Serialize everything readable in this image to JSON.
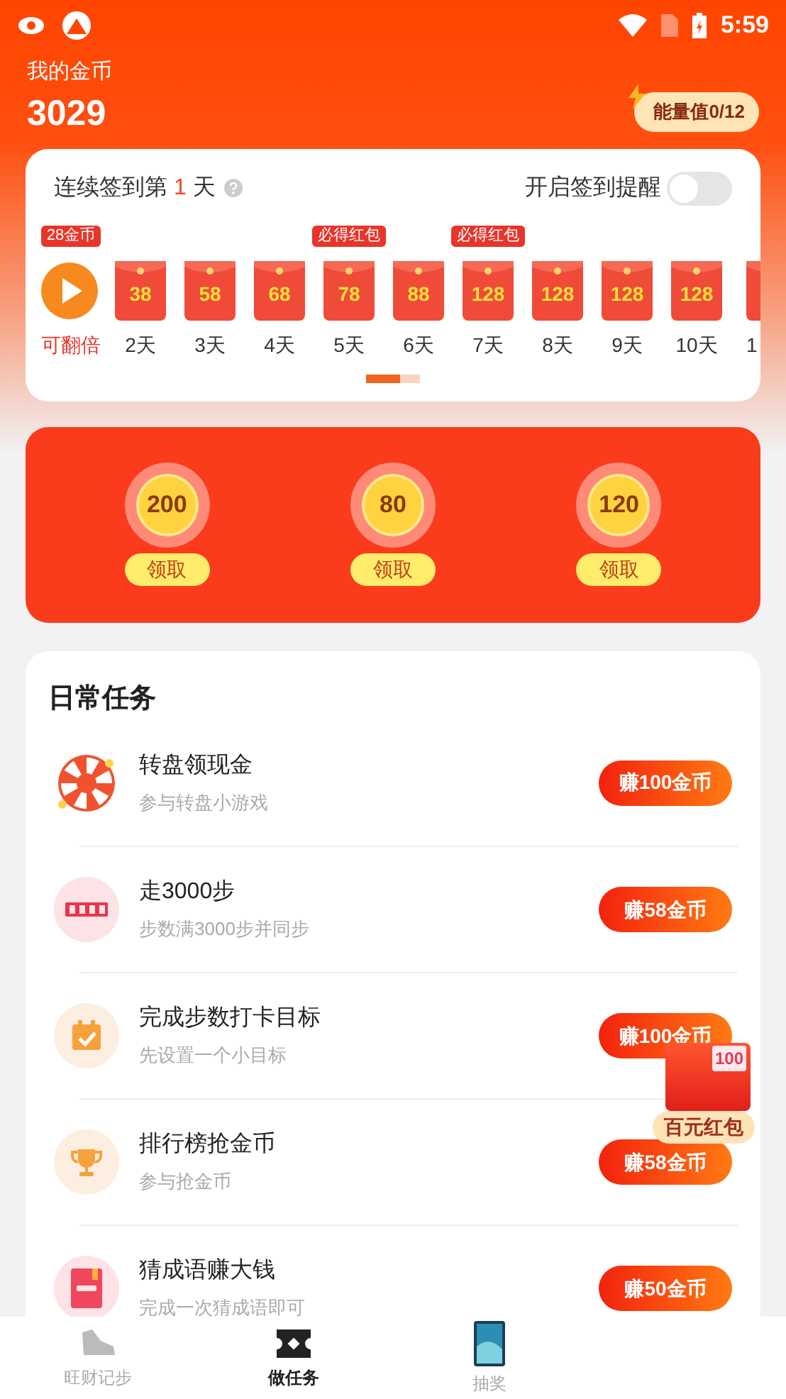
{
  "status_bar": {
    "time": "5:59"
  },
  "header": {
    "label": "我的金币",
    "coins": "3029",
    "energy": "能量值0/12"
  },
  "checkin": {
    "title_before": "连续签到第",
    "day": "1",
    "title_after": "天",
    "reminder_label": "开启签到提醒",
    "reminder_on": false,
    "days": [
      {
        "kind": "video",
        "label": "可翻倍",
        "badge": "28金币"
      },
      {
        "kind": "packet",
        "label": "2天",
        "amount": "38"
      },
      {
        "kind": "packet",
        "label": "3天",
        "amount": "58"
      },
      {
        "kind": "packet",
        "label": "4天",
        "amount": "68"
      },
      {
        "kind": "packet",
        "label": "5天",
        "amount": "78",
        "badge": "必得红包"
      },
      {
        "kind": "packet",
        "label": "6天",
        "amount": "88"
      },
      {
        "kind": "packet",
        "label": "7天",
        "amount": "128",
        "badge": "必得红包"
      },
      {
        "kind": "packet",
        "label": "8天",
        "amount": "128"
      },
      {
        "kind": "packet",
        "label": "9天",
        "amount": "128"
      },
      {
        "kind": "packet",
        "label": "10天",
        "amount": "128"
      },
      {
        "kind": "packet",
        "label": "1"
      }
    ]
  },
  "rewards": [
    {
      "amount": "200",
      "button": "领取"
    },
    {
      "amount": "80",
      "button": "领取"
    },
    {
      "amount": "120",
      "button": "领取"
    }
  ],
  "tasks": {
    "title": "日常任务",
    "items": [
      {
        "kind": "wheel",
        "title": "转盘领现金",
        "subtitle": "参与转盘小游戏",
        "button": "赚100金币"
      },
      {
        "kind": "steps",
        "title": "走3000步",
        "subtitle": "步数满3000步并同步",
        "button": "赚58金币"
      },
      {
        "kind": "calendar",
        "title": "完成步数打卡目标",
        "subtitle": "先设置一个小目标",
        "button": "赚100金币"
      },
      {
        "kind": "trophy",
        "title": "排行榜抢金币",
        "subtitle": "参与抢金币",
        "button": "赚58金币"
      },
      {
        "kind": "idiom",
        "title": "猜成语赚大钱",
        "subtitle": "完成一次猜成语即可",
        "button": "赚50金币"
      }
    ]
  },
  "floating_packet": {
    "amount": "100",
    "label": "百元红包"
  },
  "bottom_nav": [
    {
      "kind": "shoe",
      "label": "旺财记步",
      "selected": false
    },
    {
      "kind": "ticket",
      "label": "做任务",
      "selected": true
    },
    {
      "kind": "phone",
      "label": "抽奖",
      "selected": false
    }
  ]
}
